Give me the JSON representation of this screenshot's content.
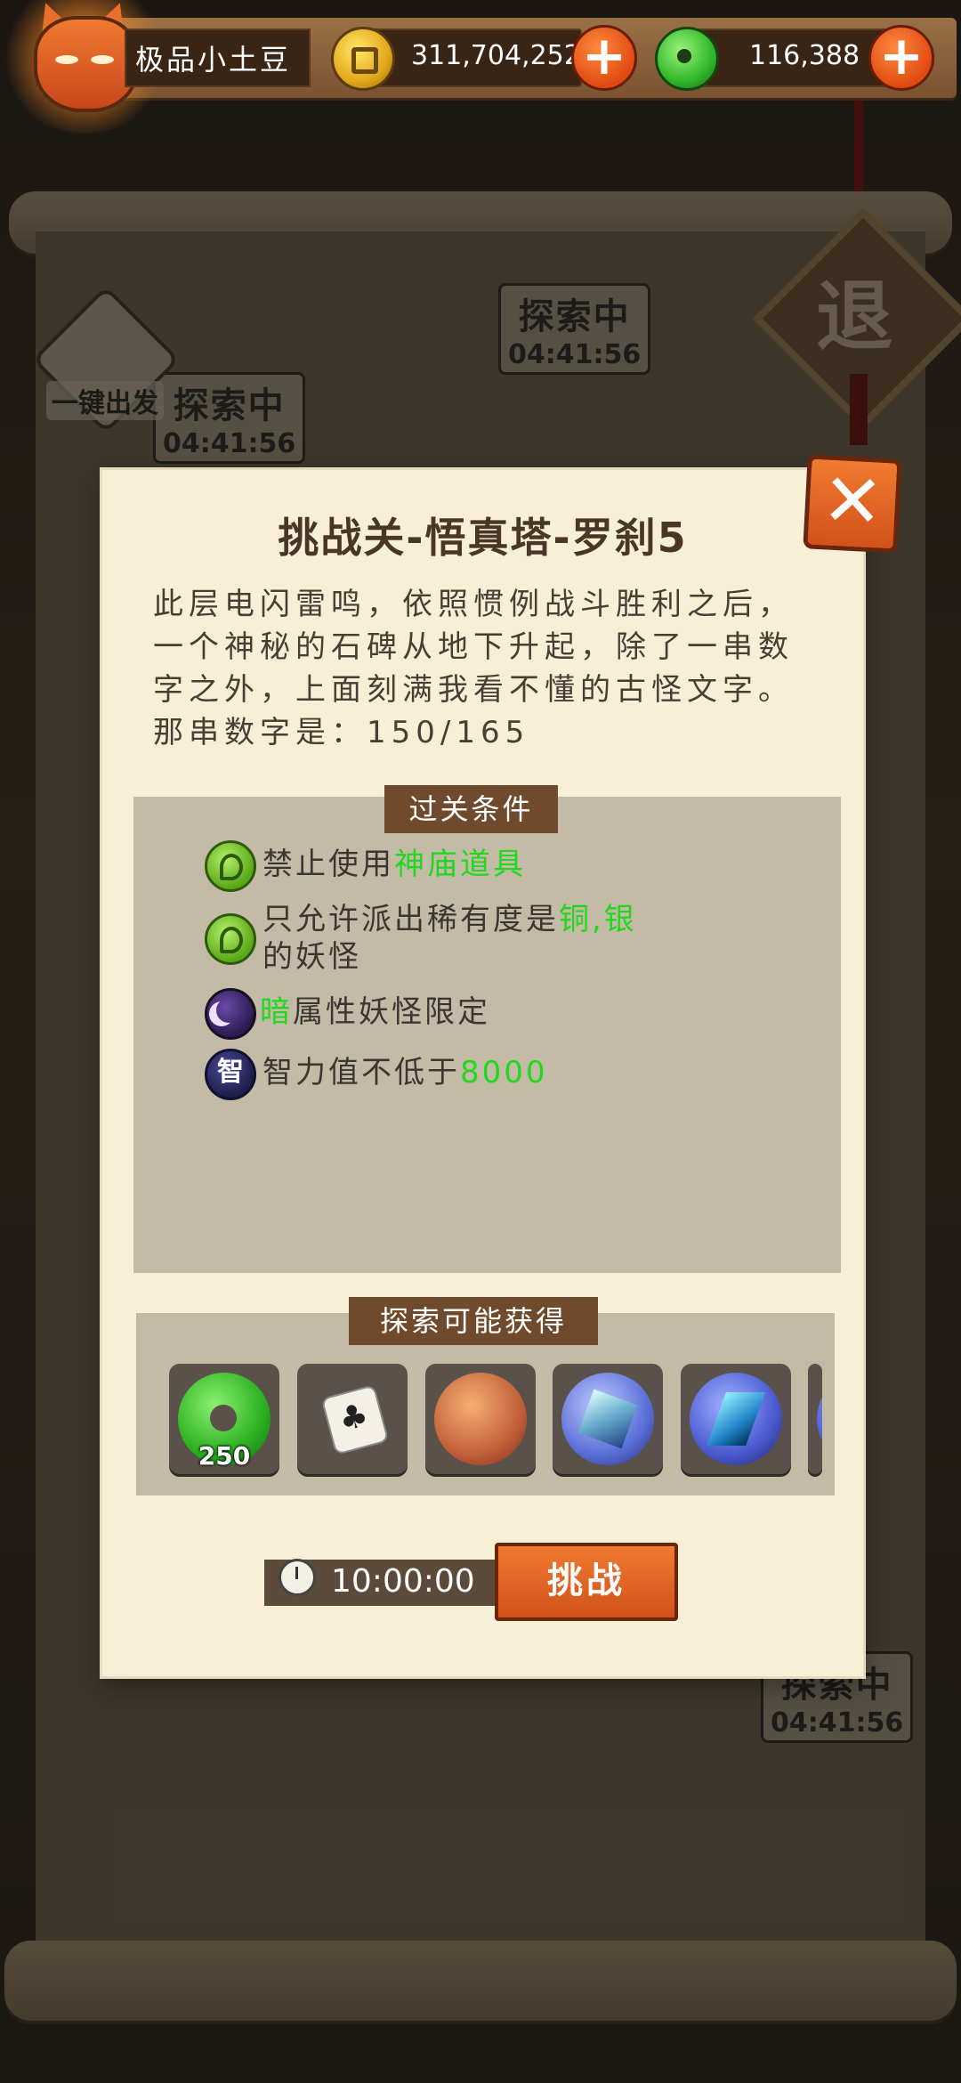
{
  "topbar": {
    "nickname": "极品小土豆",
    "gold": "311,704,252",
    "jade": "116,388",
    "gold_icon": "gold-coin-icon",
    "jade_icon": "jade-coin-icon"
  },
  "background": {
    "explore_tag_1": {
      "status": "探索中",
      "time": "04:41:56"
    },
    "explore_tag_2": {
      "status": "探索中",
      "time": "04:41:56"
    },
    "explore_tag_3": {
      "status": "探索中",
      "time": "04:41:56"
    },
    "one_click_label": "一键出发",
    "exit_label": "退"
  },
  "modal": {
    "title": "挑战关-悟真塔-罗刹5",
    "description": "此层电闪雷鸣，依照惯例战斗胜利之后，一个神秘的石碑从地下升起，除了一串数字之外，上面刻满我看不懂的古怪文字。那串数字是：150/165",
    "conditions_label": "过关条件",
    "conditions": [
      {
        "icon": "green-rule-icon",
        "prefix": "禁止使用",
        "highlight": "神庙道具",
        "suffix": ""
      },
      {
        "icon": "green-rule-icon",
        "prefix": "只允许派出稀有度是",
        "highlight": "铜,银",
        "suffix": "的妖怪"
      },
      {
        "icon": "dark-element-icon",
        "prefix": "",
        "highlight": "暗",
        "suffix": "属性妖怪限定"
      },
      {
        "icon": "intelligence-icon",
        "icon_text": "智",
        "prefix": "智力值不低于",
        "highlight": "8000",
        "suffix": ""
      }
    ],
    "rewards_label": "探索可能获得",
    "rewards": [
      {
        "icon": "jade-coin-icon",
        "count": "250"
      },
      {
        "icon": "dice-card-icon",
        "count": ""
      },
      {
        "icon": "crab-badge-icon",
        "count": ""
      },
      {
        "icon": "ice-cube-icon",
        "count": ""
      },
      {
        "icon": "crystal-shard-icon",
        "count": ""
      },
      {
        "icon": "partial-reward-icon",
        "count": ""
      }
    ],
    "timer": "10:00:00",
    "challenge_button": "挑战",
    "close_icon": "close-icon"
  },
  "colors": {
    "highlight": "#22d81e",
    "accent_orange": "#e0621e",
    "modal_bg": "#f7efd6",
    "panel_bg": "#c3bba6",
    "label_bg": "#6f4a2c"
  }
}
